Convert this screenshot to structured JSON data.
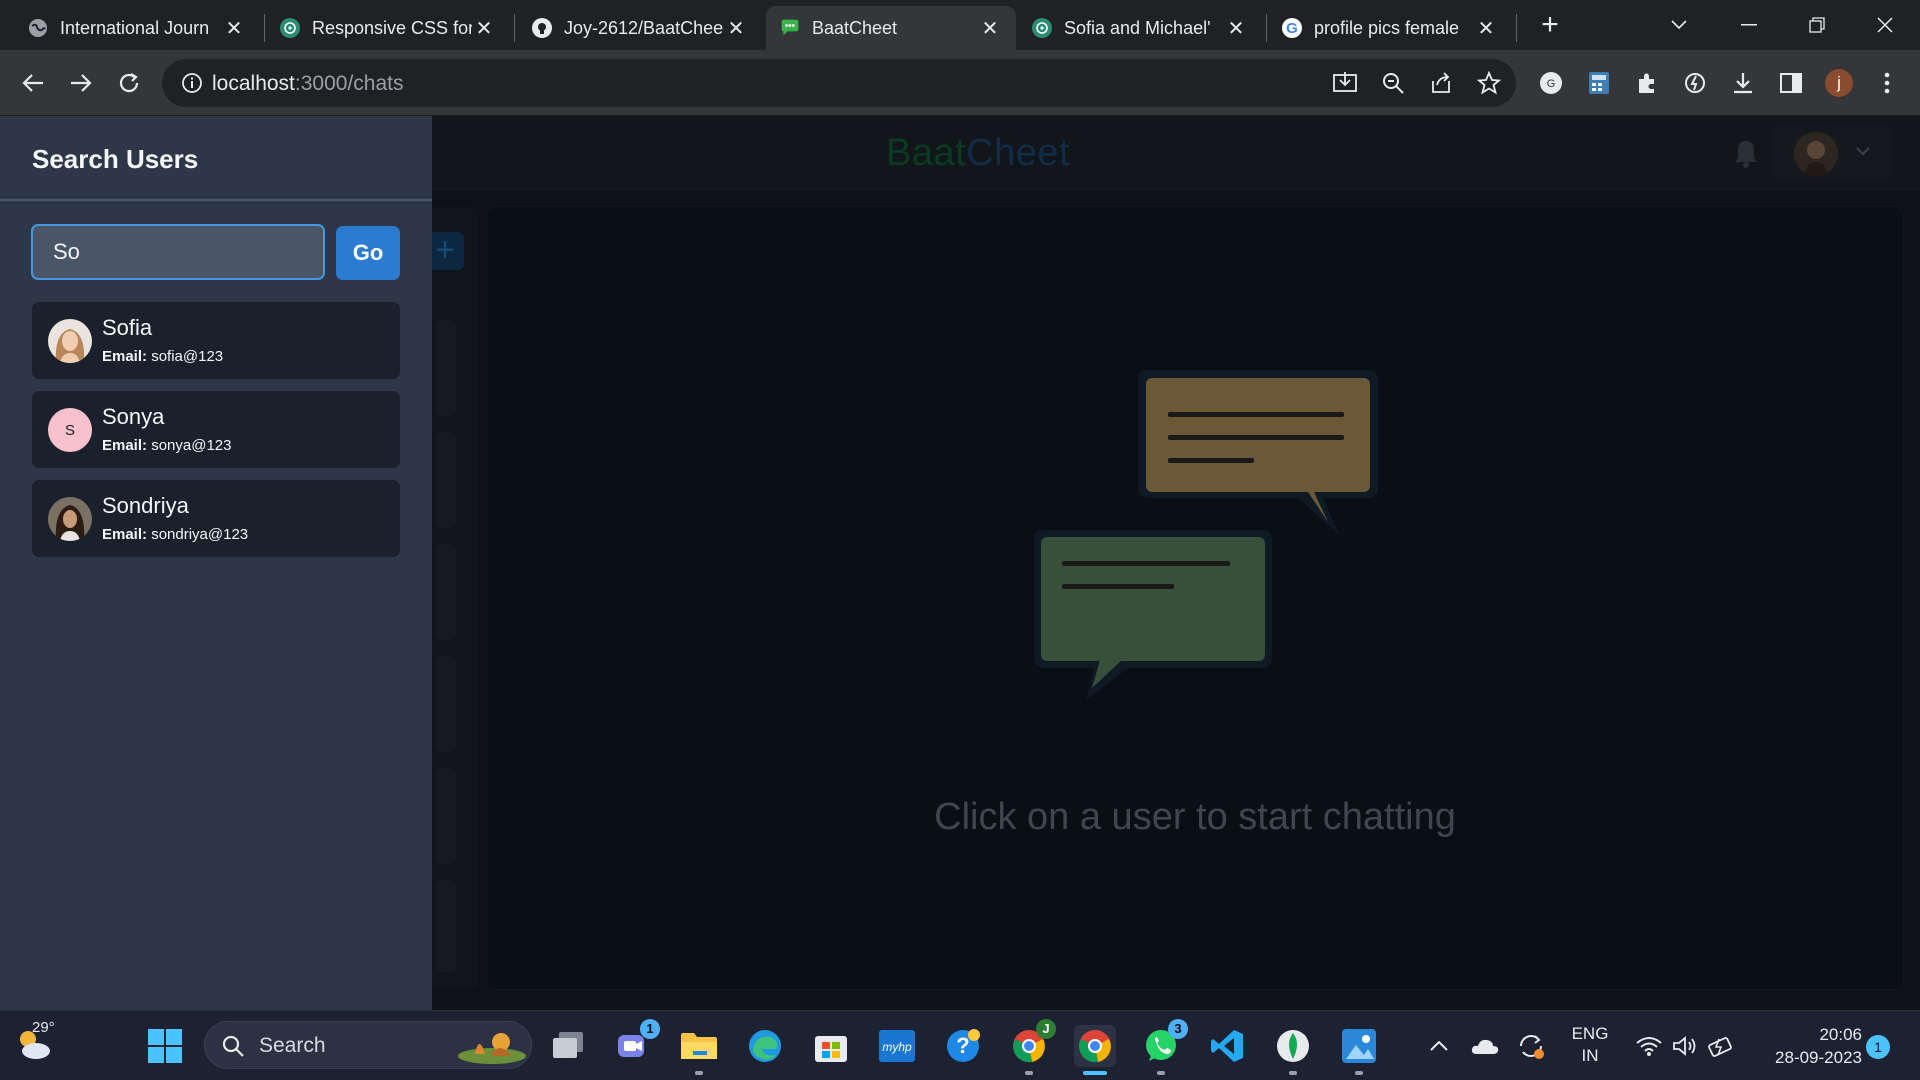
{
  "browser": {
    "tabs": [
      {
        "title": "International Journ",
        "icon": "globe-icon"
      },
      {
        "title": "Responsive CSS for",
        "icon": "chatgpt-icon"
      },
      {
        "title": "Joy-2612/BaatChee",
        "icon": "github-icon"
      },
      {
        "title": "BaatCheet",
        "icon": "chat-bubble-icon",
        "active": true
      },
      {
        "title": "Sofia and Michael'",
        "icon": "chatgpt-icon"
      },
      {
        "title": "profile pics female",
        "icon": "google-icon"
      }
    ],
    "url_host": "localhost",
    "url_path": ":3000/chats",
    "profile_initial": "j"
  },
  "app": {
    "brand_part1": "Baat",
    "brand_part2": "Cheet",
    "new_group_label": "+",
    "empty_message": "Click on a user to start chatting"
  },
  "drawer": {
    "title": "Search Users",
    "search_value": "So",
    "go_label": "Go",
    "email_label": "Email:",
    "results": [
      {
        "name": "Sofia",
        "email": "sofia@123",
        "avatar": "photo"
      },
      {
        "name": "Sonya",
        "email": "sonya@123",
        "avatar": "initial",
        "initial": "S",
        "avatar_color": "#f8c1cc"
      },
      {
        "name": "Sondriya",
        "email": "sondriya@123",
        "avatar": "photo"
      }
    ]
  },
  "taskbar": {
    "weather_temp": "29°",
    "search_label": "Search",
    "teams_badge": "1",
    "chrome_profile_badge": "J",
    "whatsapp_badge": "3",
    "lang_line1": "ENG",
    "lang_line2": "IN",
    "time": "20:06",
    "date": "28-09-2023",
    "notification_count": "1"
  },
  "colors": {
    "drawer_bg": "#2d3748",
    "card_bg": "#1a202c",
    "accent_blue": "#2b7bd0",
    "input_border": "#4299e1"
  }
}
